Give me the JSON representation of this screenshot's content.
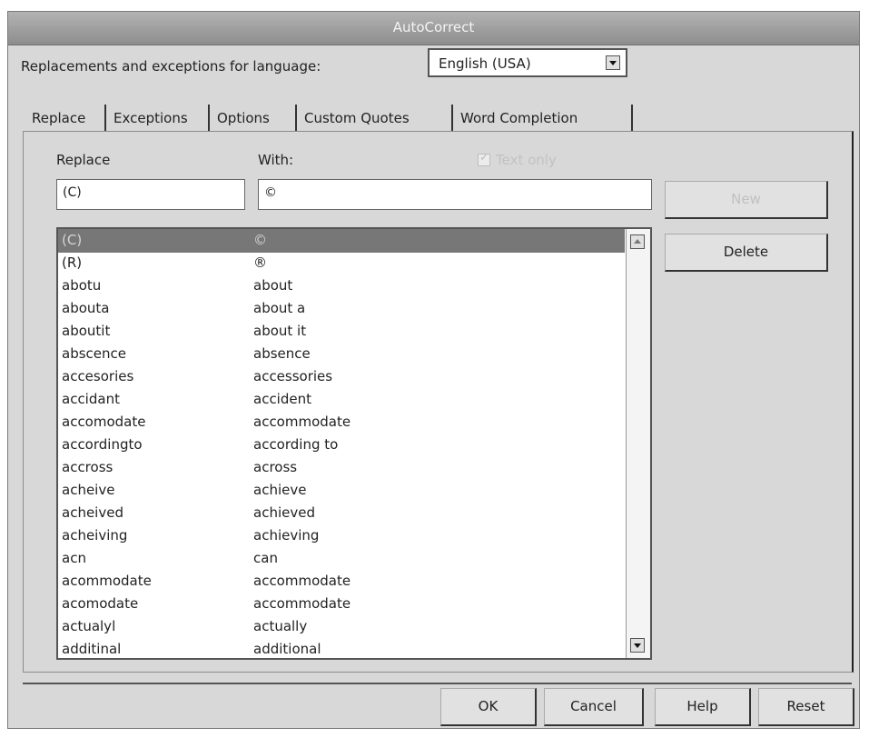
{
  "window": {
    "title": "AutoCorrect"
  },
  "language": {
    "label": "Replacements and exceptions for language:",
    "selected": "English (USA)"
  },
  "tabs": [
    {
      "label": "Replace"
    },
    {
      "label": "Exceptions"
    },
    {
      "label": "Options"
    },
    {
      "label": "Custom Quotes"
    },
    {
      "label": "Word Completion"
    }
  ],
  "replace_panel": {
    "replace_label": "Replace",
    "with_label": "With:",
    "text_only_label": "Text only",
    "replace_value": "(C)",
    "with_value": "©",
    "new_button": "New",
    "delete_button": "Delete",
    "entries": [
      {
        "replace": "(C)",
        "with": "©"
      },
      {
        "replace": "(R)",
        "with": "®"
      },
      {
        "replace": "abotu",
        "with": "about"
      },
      {
        "replace": "abouta",
        "with": "about a"
      },
      {
        "replace": "aboutit",
        "with": "about it"
      },
      {
        "replace": "abscence",
        "with": "absence"
      },
      {
        "replace": "accesories",
        "with": "accessories"
      },
      {
        "replace": "accidant",
        "with": "accident"
      },
      {
        "replace": "accomodate",
        "with": "accommodate"
      },
      {
        "replace": "accordingto",
        "with": "according to"
      },
      {
        "replace": "accross",
        "with": "across"
      },
      {
        "replace": "acheive",
        "with": "achieve"
      },
      {
        "replace": "acheived",
        "with": "achieved"
      },
      {
        "replace": "acheiving",
        "with": "achieving"
      },
      {
        "replace": "acn",
        "with": "can"
      },
      {
        "replace": "acommodate",
        "with": "accommodate"
      },
      {
        "replace": "acomodate",
        "with": "accommodate"
      },
      {
        "replace": "actualyl",
        "with": "actually"
      },
      {
        "replace": "additinal",
        "with": "additional"
      }
    ]
  },
  "footer": {
    "ok": "OK",
    "cancel": "Cancel",
    "help": "Help",
    "reset": "Reset"
  }
}
